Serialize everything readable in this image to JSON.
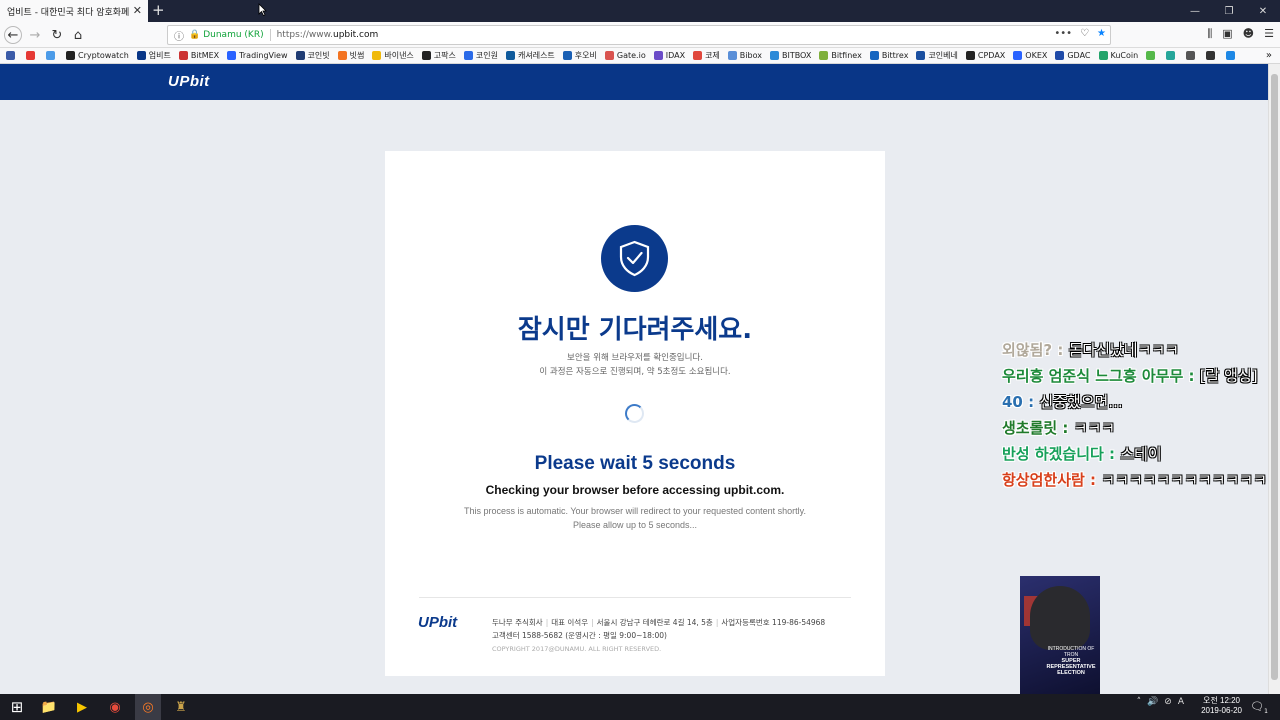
{
  "browser": {
    "tab_title": "업비트 - 대한민국 최다 암호화폐",
    "tab_close": "✕",
    "new_tab": "+",
    "window_controls": [
      "—",
      "❐",
      "✕"
    ],
    "url_org": "Dunamu (KR)",
    "url_prefix": "https://www.",
    "url_domain": "upbit.com",
    "url_actions": [
      "•••",
      "♡",
      "★"
    ],
    "right_tools": [
      "⫼",
      "▣",
      "☻",
      "☰"
    ],
    "bookmarks": [
      {
        "label": "",
        "color": "#3b5ba8"
      },
      {
        "label": "",
        "color": "#e53935"
      },
      {
        "label": "",
        "color": "#4c9be8"
      },
      {
        "label": "Cryptowatch",
        "color": "#222222"
      },
      {
        "label": "업비트",
        "color": "#093687"
      },
      {
        "label": "BitMEX",
        "color": "#cc3333"
      },
      {
        "label": "TradingView",
        "color": "#2962ff"
      },
      {
        "label": "코인빗",
        "color": "#1f3b73"
      },
      {
        "label": "빗썸",
        "color": "#f37321"
      },
      {
        "label": "바이낸스",
        "color": "#f0b90b"
      },
      {
        "label": "고팍스",
        "color": "#222222"
      },
      {
        "label": "코인원",
        "color": "#2a6ae8"
      },
      {
        "label": "캐셔레스트",
        "color": "#0f5a9c"
      },
      {
        "label": "후오비",
        "color": "#1a5fb4"
      },
      {
        "label": "Gate.io",
        "color": "#d9534f"
      },
      {
        "label": "IDAX",
        "color": "#6b4cc8"
      },
      {
        "label": "코제",
        "color": "#e0473c"
      },
      {
        "label": "Bibox",
        "color": "#5a8fd8"
      },
      {
        "label": "BITBOX",
        "color": "#2c8ad8"
      },
      {
        "label": "Bitfinex",
        "color": "#7fb03c"
      },
      {
        "label": "Bittrex",
        "color": "#1565c0"
      },
      {
        "label": "코인베네",
        "color": "#1a4fa0"
      },
      {
        "label": "CPDAX",
        "color": "#222222"
      },
      {
        "label": "OKEX",
        "color": "#2962ff"
      },
      {
        "label": "GDAC",
        "color": "#1f4aa8"
      },
      {
        "label": "KuCoin",
        "color": "#23a46b"
      },
      {
        "label": "",
        "color": "#55b84a"
      },
      {
        "label": "",
        "color": "#26a69a"
      },
      {
        "label": "",
        "color": "#555555"
      },
      {
        "label": "",
        "color": "#333333"
      },
      {
        "label": "",
        "color": "#1e88e5"
      }
    ],
    "bookmarks_more": "»"
  },
  "page": {
    "logo": "UPbit",
    "ko_title": "잠시만 기다려주세요.",
    "ko_sub_1": "보안을 위해 브라우저를 확인중입니다.",
    "ko_sub_2": "이 과정은 자동으로 진행되며, 약 5초정도 소요됩니다.",
    "en_title": "Please wait 5 seconds",
    "en_check": "Checking your browser before accessing upbit.com.",
    "en_sub_1": "This process is automatic. Your browser will redirect to your requested content shortly.",
    "en_sub_2": "Please allow up to 5 seconds...",
    "footer": {
      "logo": "UPbit",
      "company": "두나무 주식회사",
      "ceo": "대표 이석우",
      "address": "서울시 강남구 테헤란로 4길 14, 5층",
      "biz_no": "사업자등록번호 119-86-54968",
      "cs": "고객센터 1588-5682 (운영시간 : 평일 9:00~18:00)",
      "copyright": "COPYRIGHT 2017@DUNAMU. ALL RIGHT RESERVED."
    }
  },
  "chat": [
    {
      "user": "외않됨?",
      "sep": " : ",
      "msg": "돋다신났네ㅋㅋㅋ",
      "color": "#b0a89a"
    },
    {
      "user": "우리흥 엄준식 느그흥 아무무",
      "sep": " : ",
      "msg": "[랄 앵싱]",
      "color": "#1d8a3a"
    },
    {
      "user": "40",
      "sep": " : ",
      "msg": "신중했으면...",
      "color": "#2a6fb0"
    },
    {
      "user": "생초롤릿",
      "sep": " : ",
      "msg": "ㅋㅋㅋ",
      "color": "#1f7a2a"
    },
    {
      "user": "반성 하겠습니다",
      "sep": " : ",
      "msg": "스테이",
      "color": "#16a05a"
    },
    {
      "user": "항상엄한사람",
      "sep": " : ",
      "msg": "ㅋㅋㅋㅋㅋㅋㅋㅋㅋㅋㅋㅋ",
      "color": "#d8401c"
    }
  ],
  "video": {
    "caption_small": "INTRODUCTION OF TRON",
    "caption_1": "SUPER",
    "caption_2": "REPRESENTATIVE",
    "caption_3": "ELECTION"
  },
  "taskbar": {
    "start": "⊞",
    "apps": [
      "📁",
      "▶",
      "◉",
      "◎",
      "♜"
    ],
    "tray_icons": [
      "˄",
      "🔊",
      "⊘",
      "A"
    ],
    "time": "오전 12:20",
    "date": "2019-06-20",
    "notifications": "🗨",
    "notif_count": "1"
  }
}
